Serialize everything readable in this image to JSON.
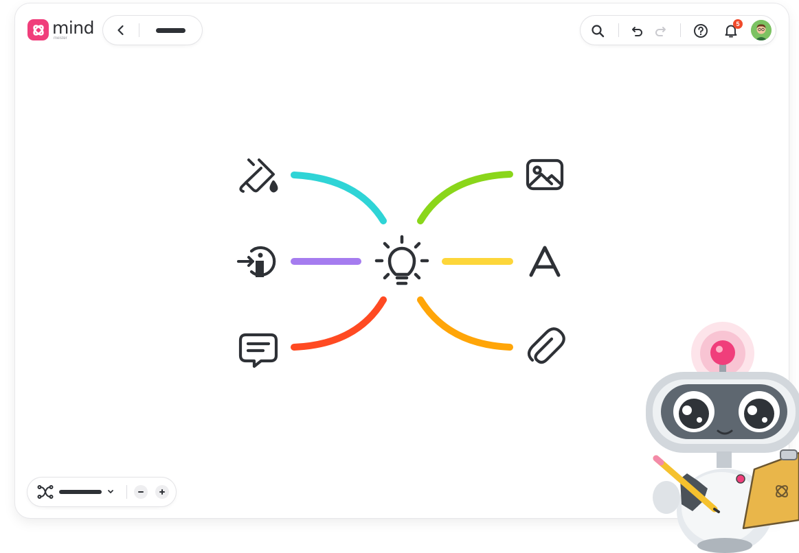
{
  "app": {
    "logo_text": "mind",
    "logo_subtext": "meister"
  },
  "header": {
    "back_icon": "chevron-left-icon",
    "map_title_placeholder": "title-bar"
  },
  "toolbar": {
    "icons": [
      "search-icon",
      "undo-icon",
      "redo-icon",
      "help-icon",
      "bell-icon"
    ],
    "notification_count": "5"
  },
  "bottom_bar": {
    "layout_icon": "mindmap-layout-icon",
    "zoom_out_icon": "minus-icon",
    "zoom_in_icon": "plus-icon"
  },
  "mind_map": {
    "center_icon": "lightbulb-icon",
    "branches": [
      {
        "side": "left",
        "icon": "paint-bucket-icon",
        "color": "#2fd4d6"
      },
      {
        "side": "left",
        "icon": "info-enter-icon",
        "color": "#a57cef"
      },
      {
        "side": "left",
        "icon": "comment-icon",
        "color": "#ff4a22"
      },
      {
        "side": "right",
        "icon": "image-icon",
        "color": "#8ad61a"
      },
      {
        "side": "right",
        "icon": "text-a-icon",
        "color": "#fdd63a"
      },
      {
        "side": "right",
        "icon": "paperclip-icon",
        "color": "#ffa508"
      }
    ]
  },
  "colors": {
    "brand": "#f03e7b",
    "badge": "#f04a2b",
    "icon": "#2e3136"
  }
}
